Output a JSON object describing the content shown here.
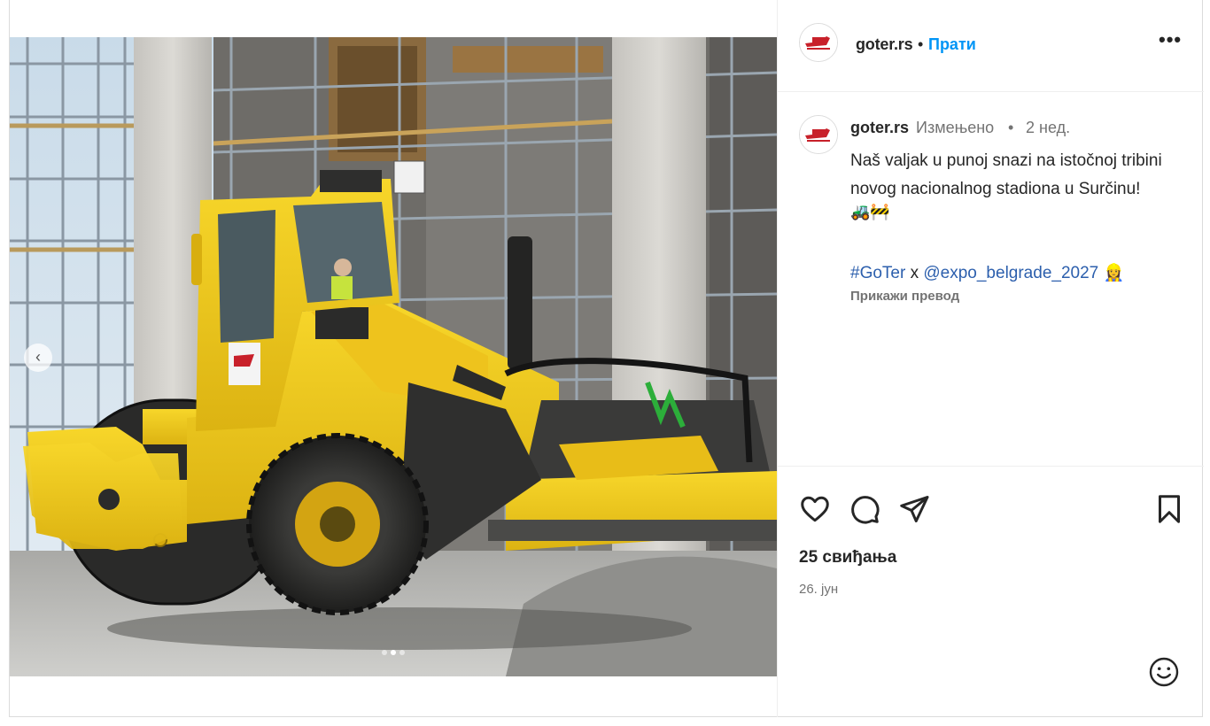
{
  "post": {
    "account": "goter.rs",
    "follow_label": "Прати",
    "header_separator": "•",
    "more_label": "•••"
  },
  "caption": {
    "account": "goter.rs",
    "edited_label": "Измењено",
    "separator": "•",
    "time": "2 нед.",
    "text": "Naš valjak u punoj snazi na istočnoj tribini novog nacionalnog stadiona u Surčinu!",
    "emojis": "🚜🚧",
    "hashtag": "#GoTer",
    "tag_joiner": " x ",
    "mention": "@expo_belgrade_2027",
    "mention_emoji": "👷‍♀️",
    "translate_label": "Прикажи превод"
  },
  "engagement": {
    "likes": "25 свиђања",
    "date": "26. јун"
  },
  "comment": {
    "placeholder": ""
  },
  "carousel": {
    "slide_count": 3,
    "active_slide": 2
  },
  "icons": {
    "like": "heart-icon",
    "comment": "comment-bubble-icon",
    "share": "paper-plane-icon",
    "save": "bookmark-icon",
    "emoji": "smiley-icon",
    "prev": "chevron-left-icon"
  },
  "colors": {
    "follow": "#0095f6",
    "link": "#2c5fad",
    "secondary_text": "#737373",
    "roller_yellow": "#f2cc1b"
  }
}
